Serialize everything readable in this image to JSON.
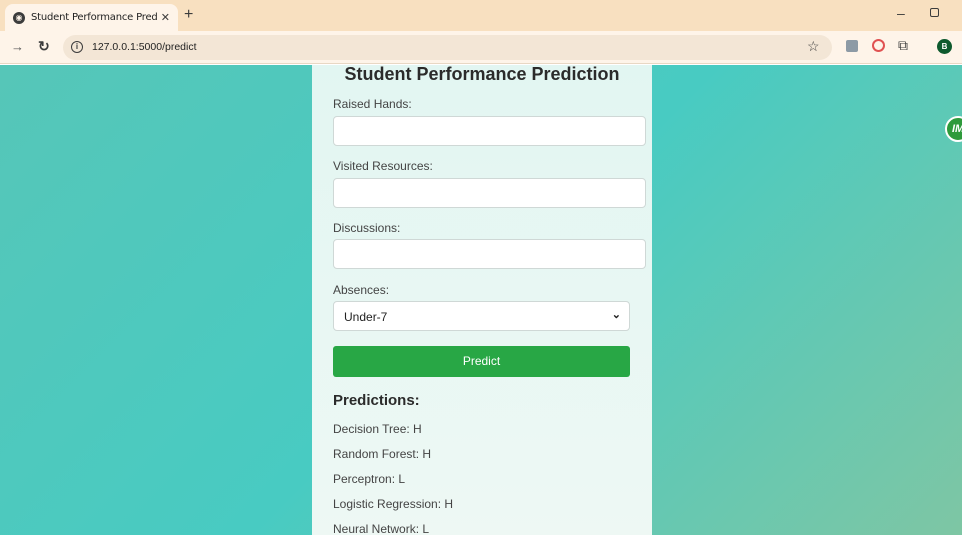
{
  "browser": {
    "tab_title": "Student Performance Prediction",
    "url": "127.0.0.1:5000/predict",
    "profile_initial": "B"
  },
  "page": {
    "title": "Student Performance Prediction",
    "side_badge": "IM",
    "fields": {
      "raised_hands": {
        "label": "Raised Hands:",
        "value": ""
      },
      "visited_resources": {
        "label": "Visited Resources:",
        "value": ""
      },
      "discussions": {
        "label": "Discussions:",
        "value": ""
      },
      "absences": {
        "label": "Absences:",
        "selected": "Under-7"
      }
    },
    "predict_button": "Predict",
    "predictions": {
      "heading": "Predictions:",
      "items": [
        "Decision Tree: H",
        "Random Forest: H",
        "Perceptron: L",
        "Logistic Regression: H",
        "Neural Network: L"
      ]
    }
  },
  "colors": {
    "button": "#28a745",
    "background_gradient_start": "#56c6b8",
    "background_gradient_end": "#7ec6a4"
  }
}
